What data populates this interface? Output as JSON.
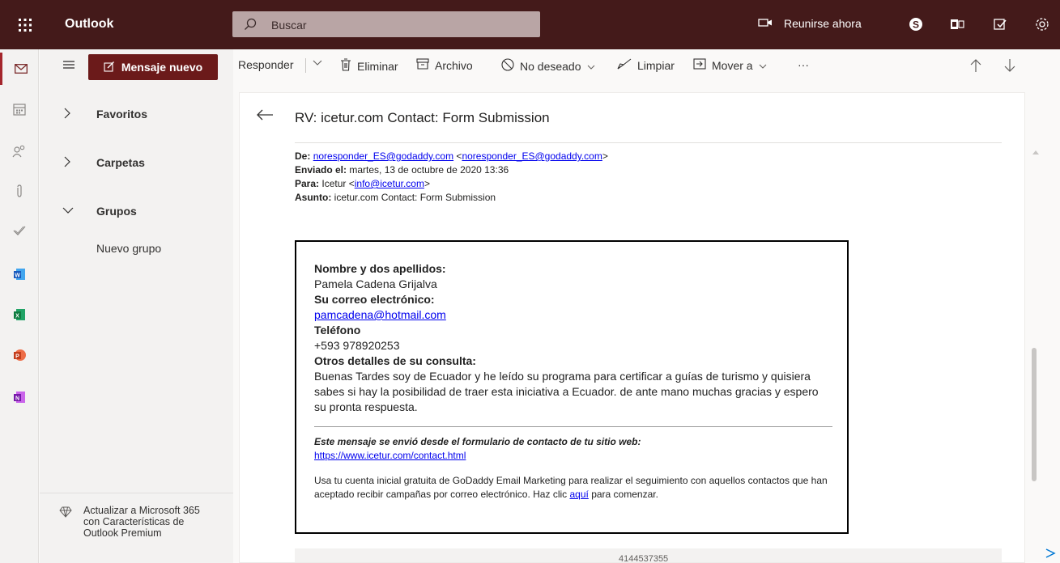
{
  "topbar": {
    "app_name": "Outlook",
    "search_placeholder": "Buscar",
    "meet_now_label": "Reunirse ahora",
    "icons": [
      "app-launcher-icon",
      "search-icon",
      "video-icon",
      "skype-icon",
      "office-icon",
      "my-day-icon",
      "settings-icon"
    ],
    "bg_color": "#441a1a"
  },
  "rail": {
    "items": [
      "mail-icon",
      "calendar-icon",
      "people-icon",
      "attachment-icon",
      "todo-icon",
      "word-icon",
      "excel-icon",
      "powerpoint-icon",
      "onenote-icon"
    ]
  },
  "folders": {
    "new_message_label": "Mensaje nuevo",
    "items": [
      {
        "label": "Favoritos",
        "expanded": false
      },
      {
        "label": "Carpetas",
        "expanded": false
      },
      {
        "label": "Grupos",
        "expanded": true
      }
    ],
    "new_group_label": "Nuevo grupo",
    "upgrade_text": "Actualizar a Microsoft 365 con Características de Outlook Premium"
  },
  "commands": {
    "reply": "Responder",
    "delete": "Eliminar",
    "archive": "Archivo",
    "junk": "No deseado",
    "sweep": "Limpiar",
    "move": "Mover a",
    "more": "···"
  },
  "message": {
    "subject": "RV: icetur.com Contact: Form Submission",
    "from_label": "De:",
    "from_email": "noresponder_ES@godaddy.com",
    "from_email_bracketed": "noresponder_ES@godaddy.com",
    "sent_label": "Enviado el:",
    "sent_value": "martes, 13 de octubre de 2020 13:36",
    "to_label": "Para:",
    "to_name": "Icetur",
    "to_email": "info@icetur.com",
    "subject_label": "Asunto:",
    "subject_value": "icetur.com Contact: Form Submission",
    "form": {
      "name_label": "Nombre y dos apellidos:",
      "name_value": "Pamela Cadena Grijalva",
      "email_label": "Su correo electrónico:",
      "email_value": "pamcadena@hotmail.com",
      "phone_label": "Teléfono",
      "phone_value": "+593 978920253",
      "details_label": "Otros detalles de su consulta:",
      "details_value": "Buenas Tardes soy de Ecuador y he leído su programa para certificar a guías de turismo y quisiera sabes si hay la posibilidad de traer esta iniciativa a Ecuador. de ante mano muchas gracias y espero su pronta respuesta.",
      "sent_from_note": "Este mensaje se envió desde el formulario de contacto de tu sitio web:",
      "site_url": "https://www.icetur.com/contact.html",
      "promo_text_1": "Usa tu cuenta inicial gratuita de GoDaddy Email Marketing para realizar el seguimiento con aquellos contactos que han aceptado recibir campañas por correo electrónico. Haz clic",
      "promo_link": "aquí",
      "promo_text_2": "para comenzar."
    },
    "footer_number": "4144537355"
  }
}
